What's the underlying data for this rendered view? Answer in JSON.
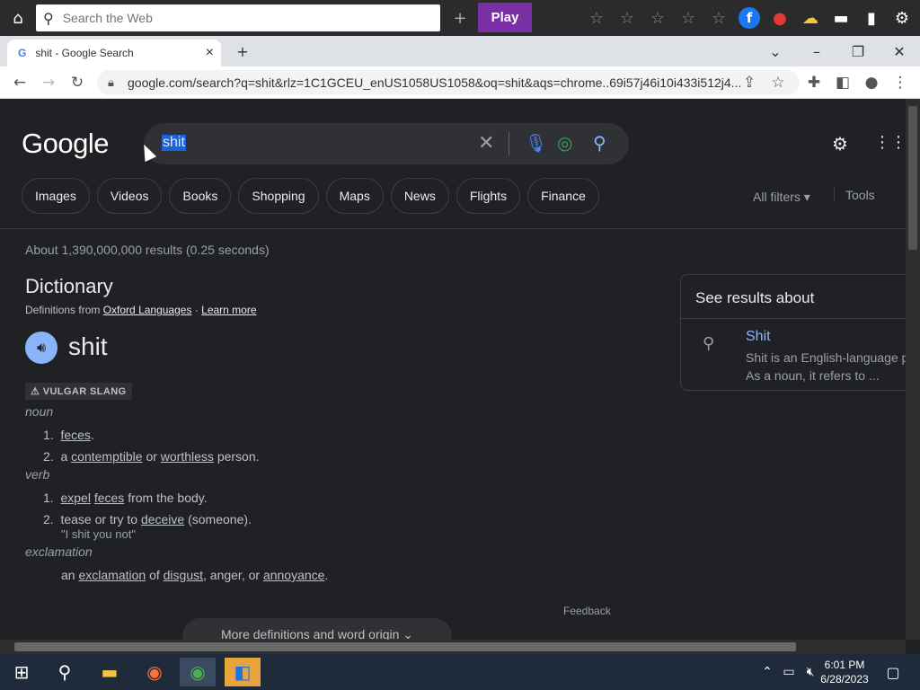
{
  "toolbar": {
    "search_placeholder": "Search the Web",
    "play_label": "Play",
    "icons": [
      "home-icon",
      "search-icon",
      "plus-icon",
      "star-icon",
      "star-icon",
      "star-icon",
      "star-icon",
      "star-icon",
      "facebook-icon",
      "ladybug-icon",
      "weather-icon",
      "folder-icon",
      "trash-icon",
      "gear-icon"
    ]
  },
  "tab": {
    "title": "shit - Google Search",
    "close": "×",
    "new_tab": "+"
  },
  "address": {
    "url": "google.com/search?q=shit&rlz=1C1GCEU_enUS1058US1058&oq=shit&aqs=chrome..69i57j46i10i433i512j4..."
  },
  "google": {
    "logo": "Google",
    "query": "shit",
    "chips": [
      "Images",
      "Videos",
      "Books",
      "Shopping",
      "Maps",
      "News",
      "Flights",
      "Finance"
    ],
    "all_filters": "All filters ▾",
    "tools": "Tools",
    "result_stats": "About 1,390,000,000 results (0.25 seconds)"
  },
  "dictionary": {
    "title": "Dictionary",
    "defs_from_prefix": "Definitions from",
    "oxford": "Oxford Languages",
    "dot": "·",
    "learn_more": "Learn more",
    "word": "shit",
    "tag": "⚠ VULGAR SLANG",
    "noun": "noun",
    "noun_def1_num": "1.",
    "noun_def1_word": "feces",
    "noun_def1_end": ".",
    "noun_def2_num": "2.",
    "noun_def2_a": "a",
    "noun_def2_w1": "contemptible",
    "noun_def2_or": "or",
    "noun_def2_w2": "worthless",
    "noun_def2_end": "person.",
    "verb": "verb",
    "verb_def1_num": "1.",
    "verb_def1_w1": "expel",
    "verb_def1_w2": "feces",
    "verb_def1_end": "from the body.",
    "verb_def2_num": "2.",
    "verb_def2_a": "tease or try to",
    "verb_def2_w": "deceive",
    "verb_def2_end": "(someone).",
    "verb_example": "\"I shit you not\"",
    "exclamation": "exclamation",
    "excl_a": "an",
    "excl_w1": "exclamation",
    "excl_of": "of",
    "excl_w2": "disgust",
    "excl_mid": ", anger, or",
    "excl_w3": "annoyance",
    "excl_end": ".",
    "feedback": "Feedback",
    "more": "More definitions and word origin ⌄"
  },
  "side_panel": {
    "title": "See results about",
    "link": "Shit",
    "desc1": "Shit is an English-language p",
    "desc2": "As a noun, it refers to ..."
  },
  "taskbar": {
    "time": "6:01 PM",
    "date": "6/28/2023"
  }
}
